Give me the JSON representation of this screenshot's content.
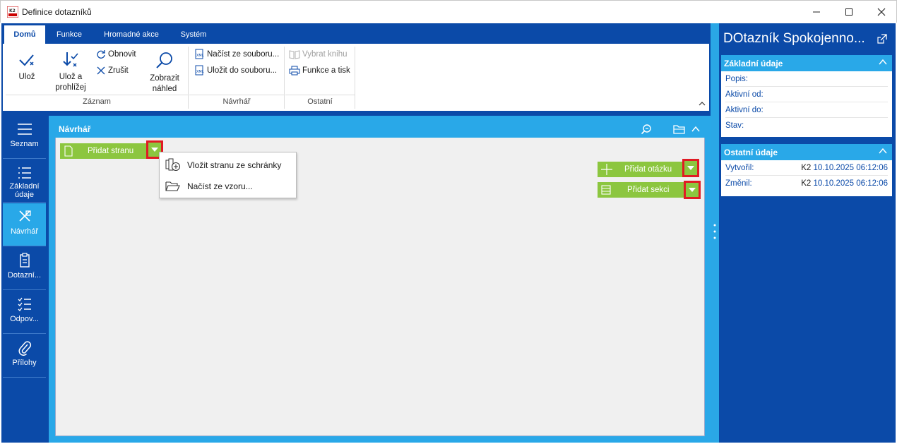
{
  "window": {
    "title": "Definice dotazníků"
  },
  "ribbon": {
    "tabs": [
      "Domů",
      "Funkce",
      "Hromadné akce",
      "Systém"
    ],
    "groups": {
      "zaznam": "Záznam",
      "navrhar": "Návrhář",
      "ostatni": "Ostatní"
    },
    "buttons": {
      "uloz": "Ulož",
      "uloz_prohlizej_1": "Ulož a",
      "uloz_prohlizej_2": "prohlížej",
      "obnovit": "Obnovit",
      "zrusit": "Zrušit",
      "zobrazit_1": "Zobrazit",
      "zobrazit_2": "náhled",
      "nacist": "Načíst ze souboru...",
      "ulozit": "Uložit do souboru...",
      "vybrat_knihu": "Vybrat knihu",
      "funkce_tisk": "Funkce a tisk"
    }
  },
  "nav": {
    "items": [
      {
        "label_1": "Seznam",
        "label_2": ""
      },
      {
        "label_1": "Základní",
        "label_2": "údaje"
      },
      {
        "label_1": "Návrhář",
        "label_2": ""
      },
      {
        "label_1": "Dotazní...",
        "label_2": ""
      },
      {
        "label_1": "Odpov...",
        "label_2": ""
      },
      {
        "label_1": "Přílohy",
        "label_2": ""
      }
    ]
  },
  "designer": {
    "title": "Návrhář",
    "add_page": "Přidat stranu",
    "add_question": "Přidat otázku",
    "add_section": "Přidat sekci",
    "menu": {
      "paste_page": "Vložit stranu ze schránky",
      "load_template": "Načíst ze vzoru..."
    }
  },
  "right_panel": {
    "title": "DOtazník Spokojenno...",
    "basic": {
      "title": "Základní údaje",
      "fields": [
        "Popis:",
        "Aktivní od:",
        "Aktivní do:",
        "Stav:"
      ]
    },
    "other": {
      "title": "Ostatní údaje",
      "created_label": "Vytvořil:",
      "created_user": "K2",
      "created_date": "10.10.2025 06:12:06",
      "changed_label": "Změnil:",
      "changed_user": "K2",
      "changed_date": "10.10.2025 06:12:06"
    }
  },
  "colors": {
    "brand": "#0b4aa8",
    "accent": "#29a8e8",
    "green": "#8cc63f",
    "highlight": "#e01b24"
  }
}
